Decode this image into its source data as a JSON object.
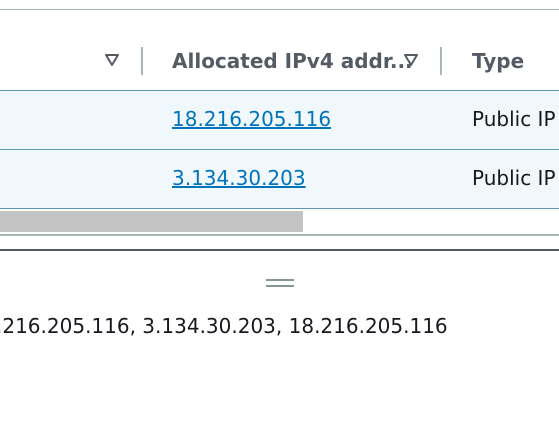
{
  "table": {
    "columns": [
      {
        "label": ""
      },
      {
        "label": "Allocated IPv4 addr..."
      },
      {
        "label": "Type"
      }
    ],
    "rows": [
      {
        "ip": "18.216.205.116",
        "type": "Public IP"
      },
      {
        "ip": "3.134.30.203",
        "type": "Public IP"
      }
    ]
  },
  "selection_summary": ".216.205.116, 3.134.30.203, 18.216.205.116",
  "colors": {
    "link": "#0073bb",
    "selected_row_bg": "#f1f8fd",
    "header_text": "#545b64"
  },
  "icons": {
    "sort": "caret-down-outline-icon",
    "resize": "drag-handle-icon"
  }
}
